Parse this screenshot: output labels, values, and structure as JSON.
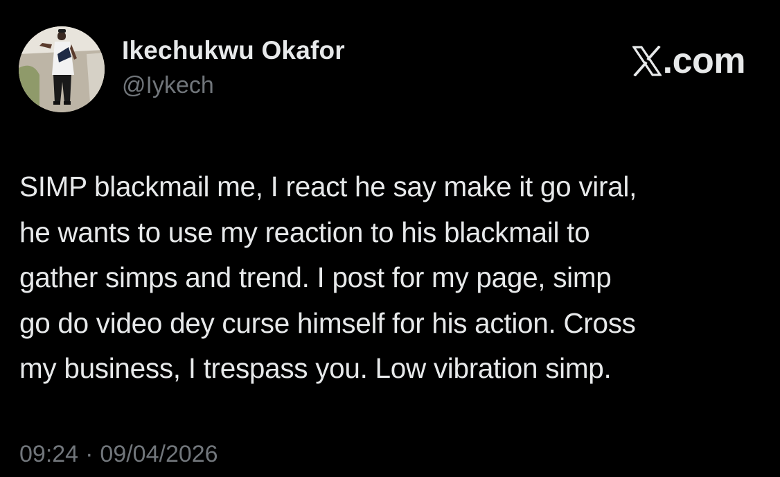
{
  "author": {
    "display_name": "Ikechukwu Okafor",
    "handle": "@Iykech"
  },
  "brand": {
    "label": ".com",
    "icon": "x-logo-icon"
  },
  "tweet": {
    "lines": [
      "SIMP blackmail me, I react he say make it go viral,",
      "he wants to use my reaction to his blackmail to",
      "gather simps and trend. I post for my page, simp",
      "go do video dey curse himself for his action. Cross",
      "my business, I trespass you. Low vibration simp."
    ]
  },
  "meta": {
    "time": "09:24",
    "separator": "·",
    "date": "09/04/2026"
  },
  "colors": {
    "background": "#000000",
    "primary_text": "#e7e9ea",
    "secondary_text": "#71767b"
  }
}
